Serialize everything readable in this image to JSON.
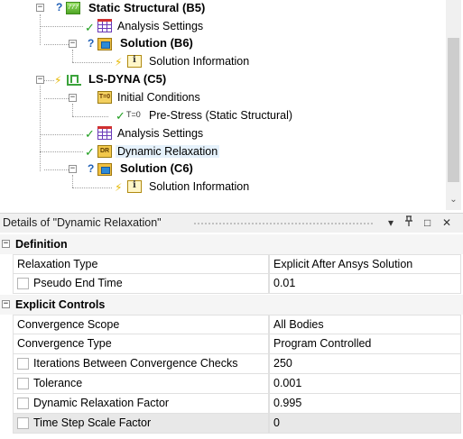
{
  "tree": {
    "items": [
      {
        "label": "Static Structural (B5)",
        "bold": true
      },
      {
        "label": "Analysis Settings",
        "bold": false
      },
      {
        "label": "Solution (B6)",
        "bold": true
      },
      {
        "label": "Solution Information",
        "bold": false
      },
      {
        "label": "LS-DYNA (C5)",
        "bold": true
      },
      {
        "label": "Initial Conditions",
        "bold": false
      },
      {
        "label": "Pre-Stress (Static Structural)",
        "bold": false
      },
      {
        "label": "Analysis Settings",
        "bold": false
      },
      {
        "label": "Dynamic Relaxation",
        "bold": false,
        "selected": true
      },
      {
        "label": "Solution (C6)",
        "bold": true
      },
      {
        "label": "Solution Information",
        "bold": false
      }
    ],
    "status": {
      "question": "?",
      "check": "✓",
      "bolt": "⚡"
    },
    "expander_minus": "−",
    "icon_t0_text": "T=0",
    "icon_prestress_text": "T=0"
  },
  "scrollbar": {
    "down_arrow": "⌄"
  },
  "details": {
    "title": "Details of \"Dynamic Relaxation\"",
    "header_buttons": [
      "▾",
      "𝟜",
      "□",
      "✕"
    ],
    "sections": [
      {
        "label": "Definition",
        "toggle": "−",
        "rows": [
          {
            "name": "Relaxation Type",
            "value": "Explicit After Ansys Solution",
            "checkbox": false
          },
          {
            "name": "Pseudo End Time",
            "value": "0.01",
            "checkbox": true
          }
        ]
      },
      {
        "label": "Explicit Controls",
        "toggle": "−",
        "rows": [
          {
            "name": "Convergence Scope",
            "value": "All Bodies",
            "checkbox": false
          },
          {
            "name": "Convergence Type",
            "value": "Program Controlled",
            "checkbox": false
          },
          {
            "name": "Iterations Between Convergence Checks",
            "value": "250",
            "checkbox": true
          },
          {
            "name": "Tolerance",
            "value": "0.001",
            "checkbox": true
          },
          {
            "name": "Dynamic Relaxation Factor",
            "value": "0.995",
            "checkbox": true
          },
          {
            "name": "Time Step Scale Factor",
            "value": "0",
            "checkbox": true
          }
        ]
      }
    ]
  },
  "colors": {
    "selection": "#e5f1fb",
    "check_green": "#1f9e1f",
    "question_blue": "#1f5fb5",
    "bolt_yellow": "#e6b800",
    "header_bg": "#f0f0f0",
    "disabled_row": "#e8e8e8"
  }
}
